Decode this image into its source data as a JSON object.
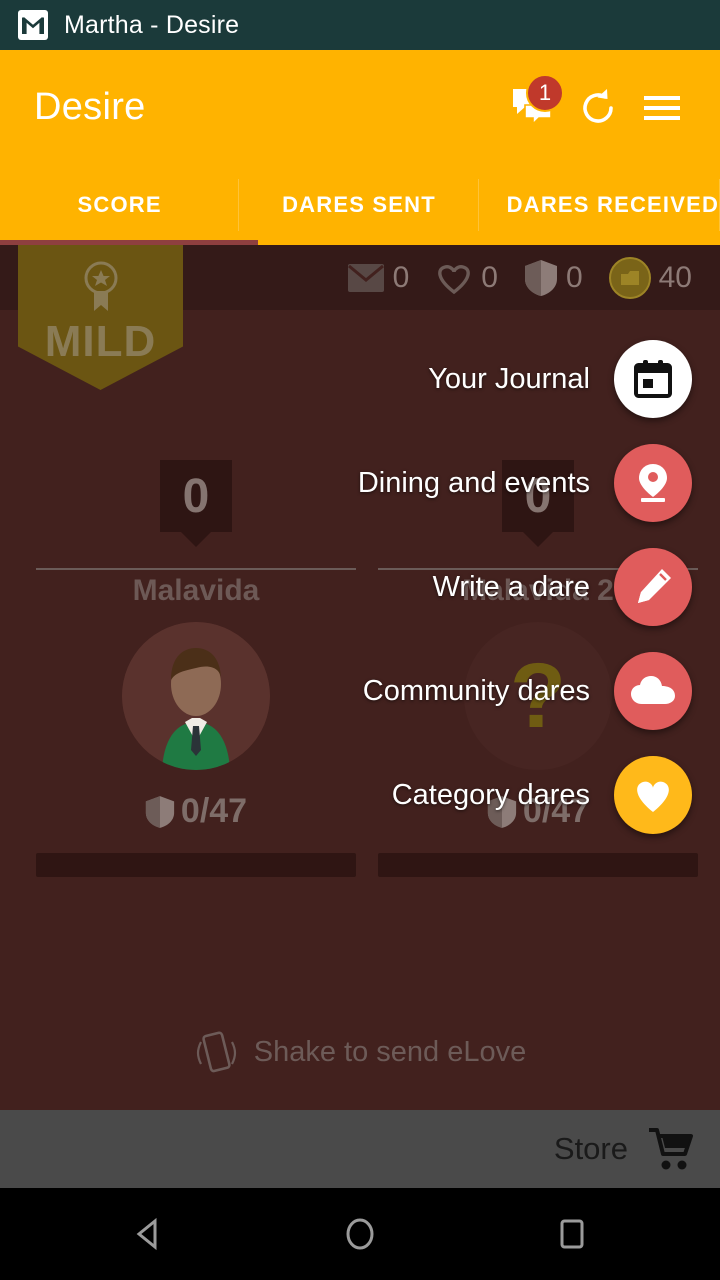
{
  "statusbar": {
    "app_icon": "gmail-icon",
    "notification_title": "Martha - Desire"
  },
  "appbar": {
    "title": "Desire",
    "actions": [
      {
        "name": "chat-icon",
        "badge": "1"
      },
      {
        "name": "refresh-icon"
      },
      {
        "name": "menu-icon"
      }
    ],
    "tabs": [
      {
        "label": "SCORE",
        "active": true
      },
      {
        "label": "DARES SENT",
        "active": false
      },
      {
        "label": "DARES RECEIVED",
        "active": false
      }
    ]
  },
  "stats": [
    {
      "icon": "mail-icon",
      "value": "0"
    },
    {
      "icon": "heart-icon",
      "value": "0"
    },
    {
      "icon": "shield-icon",
      "value": "0"
    },
    {
      "icon": "coin-icon",
      "value": "40"
    }
  ],
  "badge": {
    "icon": "award-ribbon-icon",
    "level": "MILD"
  },
  "players": [
    {
      "score": "0",
      "name": "Malavida",
      "avatar": "male-avatar",
      "dares_icon": "shield-icon",
      "dares": "0/47",
      "progress": 0
    },
    {
      "score": "0",
      "name": "Malavida 2",
      "avatar": "unknown-avatar",
      "avatar_glyph": "?",
      "dares_icon": "shield-icon",
      "dares": "0/47",
      "progress": 0
    }
  ],
  "shake": {
    "icon": "phone-shake-icon",
    "text": "Shake to send eLove"
  },
  "fab_menu": {
    "items": [
      {
        "label": "Your Journal",
        "icon": "calendar-icon",
        "style": "fab-white"
      },
      {
        "label": "Dining and events",
        "icon": "location-pin-icon",
        "style": "fab-red"
      },
      {
        "label": "Write a dare",
        "icon": "pencil-icon",
        "style": "fab-red"
      },
      {
        "label": "Community dares",
        "icon": "cloud-icon",
        "style": "fab-red"
      },
      {
        "label": "Category dares",
        "icon": "heart-icon",
        "style": "fab-yellow"
      }
    ],
    "main": {
      "icon": "close-icon"
    }
  },
  "storebar": {
    "label": "Store",
    "icon": "shopping-cart-icon"
  },
  "navbar": [
    {
      "name": "back-icon"
    },
    {
      "name": "home-icon"
    },
    {
      "name": "recents-icon"
    }
  ],
  "colors": {
    "accent_orange": "#ffb300",
    "background_maroon": "#42211e",
    "fab_red": "#e05c5c",
    "fab_yellow": "#ffb91a",
    "badge_red": "#c0392b",
    "statusbar_teal": "#1b3a3a",
    "tab_indicator": "#8e3f3f"
  }
}
